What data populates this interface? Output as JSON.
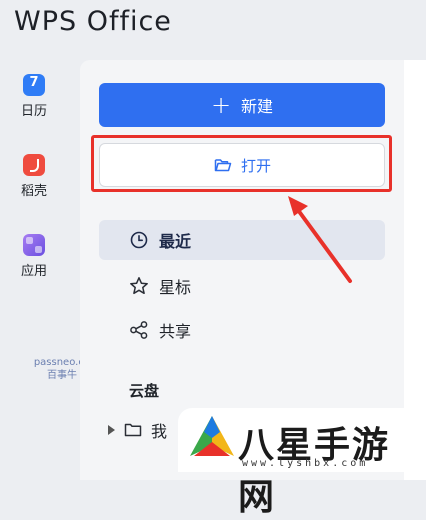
{
  "app": {
    "title": "WPS Office"
  },
  "rail": {
    "items": [
      {
        "label": "日历",
        "icon": "calendar-icon"
      },
      {
        "label": "稻壳",
        "icon": "docer-icon"
      },
      {
        "label": "应用",
        "icon": "apps-icon"
      }
    ]
  },
  "watermark": {
    "line1": "passneo.cn",
    "line2": "百事牛"
  },
  "actions": {
    "new_label": "新建",
    "open_label": "打开",
    "accent_color": "#2f6ff0",
    "highlight_color": "#e8312a"
  },
  "nav": {
    "items": [
      {
        "label": "最近",
        "icon": "clock-icon",
        "active": true
      },
      {
        "label": "星标",
        "icon": "star-icon",
        "active": false
      },
      {
        "label": "共享",
        "icon": "share-icon",
        "active": false
      }
    ]
  },
  "cloud": {
    "section_title": "云盘",
    "items": [
      {
        "label": "我",
        "icon": "folder-icon"
      }
    ]
  },
  "site_logo": {
    "text": "八星手游网",
    "url": "www.lyshbx.com"
  }
}
